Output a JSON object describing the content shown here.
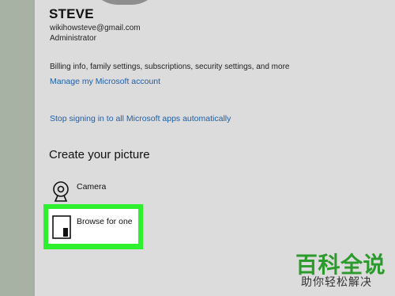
{
  "account": {
    "name": "STEVE",
    "email": "wikihowsteve@gmail.com",
    "role": "Administrator",
    "billing_text": "Billing info, family settings, subscriptions, security settings, and more",
    "manage_link": "Manage my Microsoft account",
    "stop_signin_link": "Stop signing in to all Microsoft apps automatically"
  },
  "picture": {
    "section_title": "Create your picture",
    "camera_label": "Camera",
    "browse_label": "Browse for one"
  },
  "watermark": {
    "title": "百科全说",
    "subtitle": "助你轻松解决"
  },
  "icons": {
    "camera": "camera-icon",
    "browse": "folder-icon"
  },
  "colors": {
    "highlight": "#2ff02f",
    "link": "#1f5ea8",
    "watermark_green": "#2d9a2d"
  }
}
